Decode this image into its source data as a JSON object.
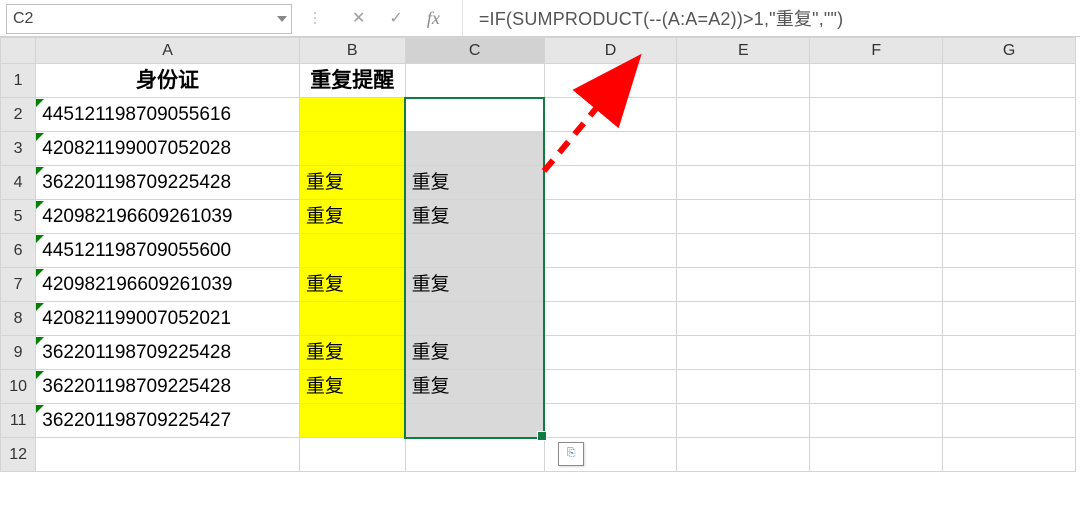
{
  "formula_bar": {
    "name_box_value": "C2",
    "formula_text": "=IF(SUMPRODUCT(--(A:A=A2))>1,\"重复\",\"\")"
  },
  "columns": [
    "A",
    "B",
    "C",
    "D",
    "E",
    "F",
    "G"
  ],
  "header_row": {
    "A": "身份证",
    "B": "重复提醒",
    "C": "",
    "D": "",
    "E": "",
    "F": "",
    "G": ""
  },
  "rows": [
    {
      "n": 2,
      "A": "445121198709055616",
      "B": "",
      "C": ""
    },
    {
      "n": 3,
      "A": "420821199007052028",
      "B": "",
      "C": ""
    },
    {
      "n": 4,
      "A": "362201198709225428",
      "B": "重复",
      "C": "重复"
    },
    {
      "n": 5,
      "A": "420982196609261039",
      "B": "重复",
      "C": "重复"
    },
    {
      "n": 6,
      "A": "445121198709055600",
      "B": "",
      "C": ""
    },
    {
      "n": 7,
      "A": "420982196609261039",
      "B": "重复",
      "C": "重复"
    },
    {
      "n": 8,
      "A": "420821199007052021",
      "B": "",
      "C": ""
    },
    {
      "n": 9,
      "A": "362201198709225428",
      "B": "重复",
      "C": "重复"
    },
    {
      "n": 10,
      "A": "362201198709225428",
      "B": "重复",
      "C": "重复"
    },
    {
      "n": 11,
      "A": "362201198709225427",
      "B": "",
      "C": ""
    }
  ],
  "blank_rows": [
    12
  ],
  "selection": {
    "ref": "C2:C11",
    "active": "C2"
  },
  "paste_tag_label": "⎘"
}
